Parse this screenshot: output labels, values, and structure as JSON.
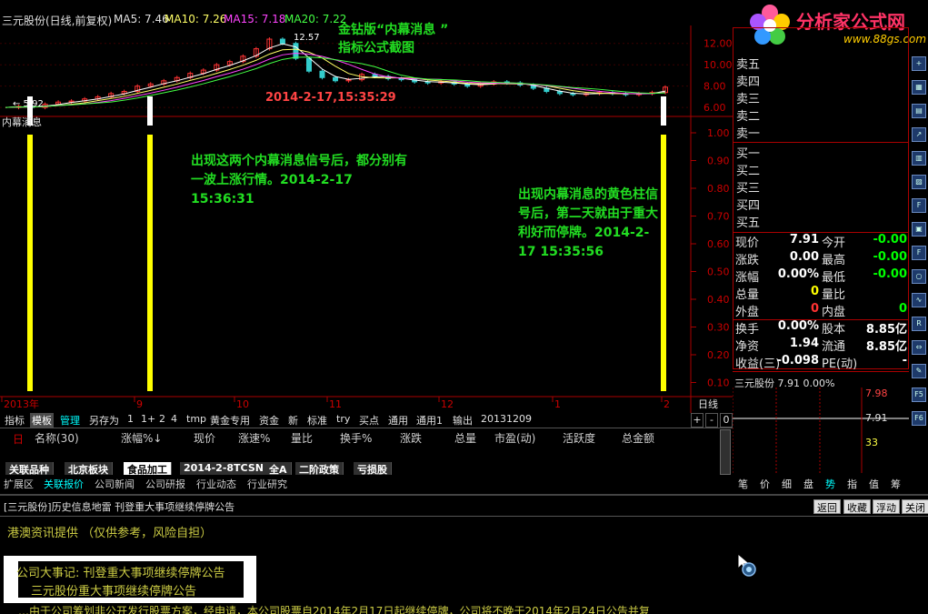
{
  "title_bar": {
    "stock": "三元股份(日线,前复权)",
    "ma5": "MA5: 7.46",
    "ma10": "MA10: 7.26",
    "ma15": "MA15: 7.18",
    "ma20": "MA20: 7.22"
  },
  "logo": {
    "text": "分析家公式网",
    "url": "www.88gs.com"
  },
  "annotations": {
    "heading1": "金钻版“内幕消息 ”",
    "heading2": "指标公式截图",
    "timestamp": "2014-2-17,15:35:29",
    "note1": "出现这两个内幕消息信号后，都分别有一波上涨行情。2014-2-17 15:36:31",
    "note2": "出现内幕消息的黄色柱信号后，第二天就由于重大利好而停牌。2014-2-17 15:35:56",
    "peak_label": "12.57",
    "low_label": "← 5.92",
    "indicator_title": "内幕消息"
  },
  "chart_data": {
    "type": "line",
    "title": "三元股份(日线,前复权)",
    "price_axis_ticks": [
      "12.00",
      "10.00",
      "8.00",
      "6.00"
    ],
    "indicator_axis_ticks": [
      "1.00",
      "0.90",
      "0.80",
      "0.70",
      "0.60",
      "0.50",
      "0.40",
      "0.30",
      "0.20",
      "0.10"
    ],
    "date_ticks": [
      "2013年",
      "9",
      "10",
      "11",
      "12",
      "1",
      "2"
    ],
    "x_axis_label": "日线",
    "ylim": [
      5.5,
      13
    ],
    "prices": [
      6.0,
      6.1,
      6.0,
      6.3,
      6.5,
      6.6,
      6.8,
      7.0,
      7.3,
      7.5,
      8.0,
      8.2,
      8.5,
      8.8,
      9.2,
      9.5,
      10.0,
      10.3,
      10.8,
      11.5,
      12.4,
      12.0,
      10.6,
      9.4,
      8.8,
      8.5,
      8.6,
      9.1,
      8.9,
      8.7,
      8.6,
      8.4,
      8.3,
      8.4,
      8.2,
      8.0,
      8.2,
      8.4,
      8.3,
      8.1,
      7.8,
      7.5,
      7.3,
      7.2,
      7.3,
      7.4,
      7.3,
      7.2,
      7.3,
      7.4,
      7.9
    ],
    "signals": [
      1,
      1,
      1
    ]
  },
  "quote": {
    "sell_labels": [
      "卖五",
      "卖四",
      "卖三",
      "卖二",
      "卖一"
    ],
    "buy_labels": [
      "买一",
      "买二",
      "买三",
      "买四",
      "买五"
    ],
    "rows": [
      {
        "l1": "现价",
        "v1": "7.91",
        "l2": "今开",
        "v2": "-0.00"
      },
      {
        "l1": "涨跌",
        "v1": "0.00",
        "l2": "最高",
        "v2": "-0.00"
      },
      {
        "l1": "涨幅",
        "v1": "0.00%",
        "l2": "最低",
        "v2": "-0.00"
      },
      {
        "l1": "总量",
        "v1": "0",
        "l2": "量比",
        "v2": ""
      },
      {
        "l1": "外盘",
        "v1": "0",
        "l2": "内盘",
        "v2": "0"
      },
      {
        "l1": "换手",
        "v1": "0.00%",
        "l2": "股本",
        "v2": "8.85亿"
      },
      {
        "l1": "净资",
        "v1": "1.94",
        "l2": "流通",
        "v2": "8.85亿"
      },
      {
        "l1": "收益(三)",
        "v1": "-0.098",
        "l2": "PE(动)",
        "v2": "-"
      }
    ],
    "mini_title": "三元股份  7.91  0.00%",
    "mini_ticks": [
      "7.98",
      "7.91",
      "33"
    ]
  },
  "toolbar": {
    "items": [
      "指标",
      "模板",
      "管理",
      "另存为",
      "1",
      "1+",
      "2",
      "4",
      "tmp",
      "黄金专用",
      "资金",
      "新",
      "标准",
      "try",
      "买点",
      "通用",
      "通用1",
      "输出",
      "20131209"
    ],
    "right": [
      "+",
      "-",
      "0"
    ]
  },
  "table_header": [
    "名称(30)",
    "涨幅%↓",
    "现价",
    "涨速%",
    "量比",
    "换手%",
    "涨跌",
    "总量",
    "市盈(动)",
    "活跃度",
    "总金额"
  ],
  "tabs": [
    "关联品种",
    "北京板块",
    "食品加工",
    "2014-2-8TCSN",
    "全A",
    "二阶政策",
    "亏损股"
  ],
  "sub_tabs": [
    "扩展区",
    "关联报价",
    "公司新闻",
    "公司研报",
    "行业动态",
    "行业研究"
  ],
  "mini_tabs": [
    "笔",
    "价",
    "细",
    "盘",
    "势",
    "指",
    "值",
    "筹"
  ],
  "news": {
    "title": "[三元股份]历史信息地雷  刊登重大事项继续停牌公告",
    "buttons": [
      "返回",
      "收藏",
      "浮动",
      "关闭"
    ],
    "source": "港澳资讯提供   （仅供参考，风险自担）",
    "headline": "公司大事记: 刊登重大事项继续停牌公告",
    "subheadline": "三元股份重大事项继续停牌公告",
    "body": "…由于公司筹划非公开发行股票方案，经申请，本公司股票自2014年2月17日起继续停牌，公司将不晚于2014年2月24日公告并复"
  },
  "colors": {
    "signal": "#ffff00",
    "annotation_green": "#22dd22",
    "timestamp_red": "#ff4444",
    "axis_red": "#cc0000",
    "value_yellow": "#ffff00",
    "value_green": "#00ff00"
  }
}
